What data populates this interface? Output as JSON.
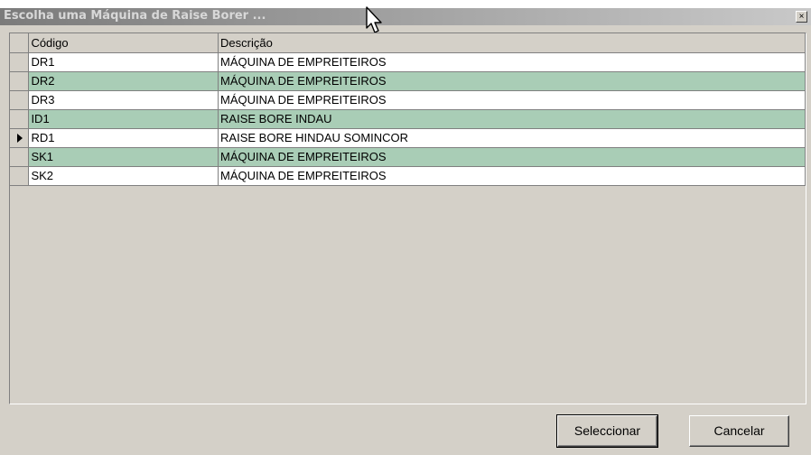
{
  "window": {
    "title": "Escolha uma Máquina de Raise Borer ...",
    "close_symbol": "×"
  },
  "grid": {
    "columns": [
      "Código",
      "Descrição"
    ],
    "rows": [
      {
        "code": "DR1",
        "desc": "MÁQUINA DE EMPREITEIROS",
        "shade": "white",
        "current": false
      },
      {
        "code": "DR2",
        "desc": "MÁQUINA DE EMPREITEIROS",
        "shade": "green",
        "current": false
      },
      {
        "code": "DR3",
        "desc": "MÁQUINA DE EMPREITEIROS",
        "shade": "white",
        "current": false
      },
      {
        "code": "ID1",
        "desc": "RAISE BORE INDAU",
        "shade": "green",
        "current": false
      },
      {
        "code": "RD1",
        "desc": "RAISE BORE HINDAU SOMINCOR",
        "shade": "white",
        "current": true
      },
      {
        "code": "SK1",
        "desc": "MÁQUINA DE EMPREITEIROS",
        "shade": "green",
        "current": false
      },
      {
        "code": "SK2",
        "desc": "MÁQUINA DE EMPREITEIROS",
        "shade": "white",
        "current": false
      }
    ]
  },
  "buttons": {
    "select_label": "Seleccionar",
    "cancel_label": "Cancelar"
  },
  "colors": {
    "row_green": "#a9cdb6",
    "row_white": "#ffffff",
    "face": "#d4d0c8"
  }
}
